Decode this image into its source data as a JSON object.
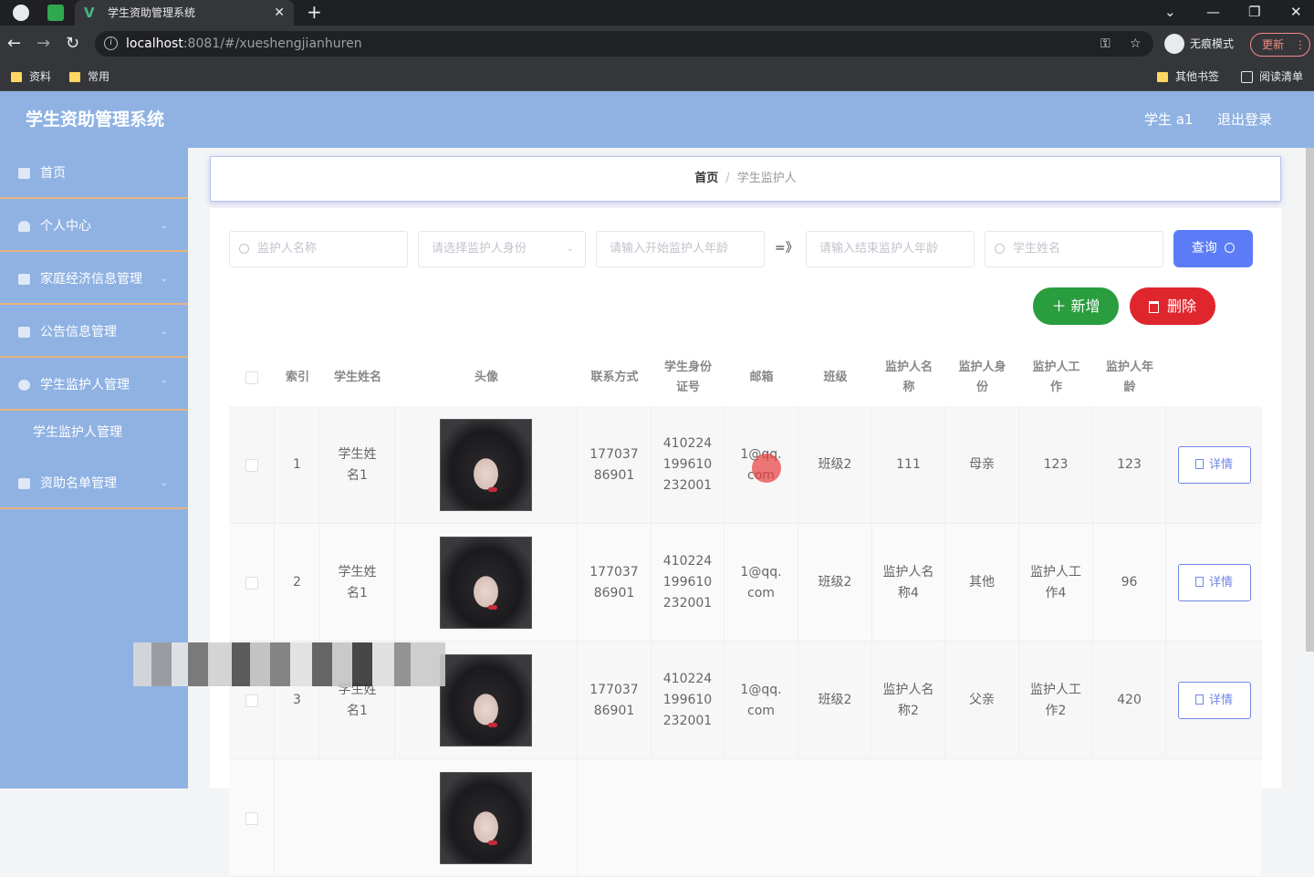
{
  "browser": {
    "tab_title": "学生资助管理系统",
    "url_host": "localhost",
    "url_path": ":8081/#/xueshengjianhuren",
    "incognito_label": "无痕模式",
    "update_label": "更新",
    "bookmarks": [
      "资料",
      "常用"
    ],
    "bookmarks_right": [
      "其他书签",
      "阅读清单"
    ]
  },
  "header": {
    "title": "学生资助管理系统",
    "user": "学生 a1",
    "logout": "退出登录"
  },
  "sidebar": {
    "items": [
      {
        "label": "首页"
      },
      {
        "label": "个人中心"
      },
      {
        "label": "家庭经济信息管理"
      },
      {
        "label": "公告信息管理"
      },
      {
        "label": "学生监护人管理"
      },
      {
        "label": "学生监护人管理"
      },
      {
        "label": "资助名单管理"
      }
    ]
  },
  "breadcrumb": {
    "home": "首页",
    "separator": "/",
    "current": "学生监护人"
  },
  "search": {
    "guardian_name_placeholder": "监护人名称",
    "guardian_identity_placeholder": "请选择监护人身份",
    "start_age_placeholder": "请输入开始监护人年龄",
    "range_symbol": "=》",
    "end_age_placeholder": "请输入结束监护人年龄",
    "student_name_placeholder": "学生姓名",
    "query_label": "查询"
  },
  "actions": {
    "add_label": "新增",
    "delete_label": "删除"
  },
  "table": {
    "headers": {
      "index": "索引",
      "student_name": "学生姓名",
      "avatar": "头像",
      "contact": "联系方式",
      "student_id": "学生身份证号",
      "email": "邮箱",
      "class": "班级",
      "guardian_name": "监护人名称",
      "guardian_identity": "监护人身份",
      "guardian_job": "监护人工作",
      "guardian_age": "监护人年龄"
    },
    "detail_label": "详情",
    "rows": [
      {
        "index": "1",
        "student_name": "学生姓名1",
        "contact": "17703786901",
        "student_id": "410224199610232001",
        "email": "1@qq.com",
        "class": "班级2",
        "guardian_name": "111",
        "guardian_identity": "母亲",
        "guardian_job": "123",
        "guardian_age": "123"
      },
      {
        "index": "2",
        "student_name": "学生姓名1",
        "contact": "17703786901",
        "student_id": "410224199610232001",
        "email": "1@qq.com",
        "class": "班级2",
        "guardian_name": "监护人名称4",
        "guardian_identity": "其他",
        "guardian_job": "监护人工作4",
        "guardian_age": "96"
      },
      {
        "index": "3",
        "student_name": "学生姓名1",
        "contact": "17703786901",
        "student_id": "410224199610232001",
        "email": "1@qq.com",
        "class": "班级2",
        "guardian_name": "监护人名称2",
        "guardian_identity": "父亲",
        "guardian_job": "监护人工作2",
        "guardian_age": "420"
      }
    ]
  },
  "colors": {
    "header_bg": "#8fb2e3",
    "query_btn": "#5b7cf6",
    "add_btn": "#2a9d3f",
    "delete_btn": "#e0262d",
    "menu_divider": "#e8b27a"
  }
}
